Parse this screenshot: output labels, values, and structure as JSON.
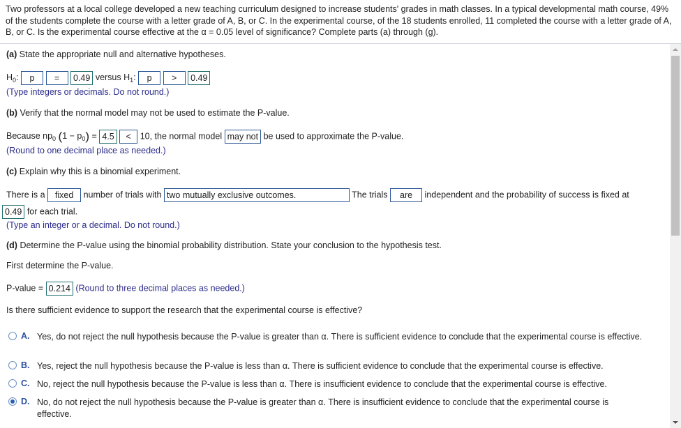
{
  "question": "Two professors at a local college developed a new teaching curriculum designed to increase students' grades in math classes. In a typical developmental math course, 49% of the students complete the course with a letter grade of A, B, or C. In the experimental course, of the 18 students enrolled, 11 completed the course with a letter grade of A, B, or C. Is the experimental course effective at the α = 0.05 level of significance? Complete parts (a) through (g).",
  "part_a": {
    "label": "(a)",
    "prompt": "State the appropriate null and alternative hypotheses.",
    "h0_label": "H",
    "h0_sub": "0",
    "h0_param": "p",
    "h0_op": "=",
    "h0_value": "0.49",
    "versus": "versus H",
    "h1_sub": "1",
    "h1_param": "p",
    "h1_op": ">",
    "h1_value": "0.49",
    "hint": "(Type integers or decimals. Do not round.)"
  },
  "part_b": {
    "label": "(b)",
    "prompt": "Verify that the normal model may not be used to estimate the P-value.",
    "because": "Because np",
    "sub0": "0",
    "one_minus": "1 − p",
    "equals": "=",
    "value": "4.5",
    "op": "<",
    "after_op": "10, the normal model",
    "may": "may not",
    "tail": "be used to approximate the P-value.",
    "hint": "(Round to one decimal place as needed.)"
  },
  "part_c": {
    "label": "(c)",
    "prompt": "Explain why this is a binomial experiment.",
    "text1": "There is a",
    "fixed": "fixed",
    "text2": "number of trials with",
    "outcomes": "two mutually exclusive outcomes.",
    "text3": "The trials",
    "are": "are",
    "text4": "independent and the probability of success is fixed at",
    "prob": "0.49",
    "text5": "for each trial.",
    "hint": "(Type an integer or a decimal. Do not round.)"
  },
  "part_d": {
    "label": "(d)",
    "prompt": "Determine the P-value using the binomial probability distribution. State your conclusion to the hypothesis test.",
    "first": "First determine the P-value.",
    "pvalue_label": "P-value =",
    "pvalue": "0.214",
    "hint": "(Round to three decimal places as needed.)",
    "question": "Is there sufficient evidence to support the research that the experimental course is effective?",
    "choices": [
      {
        "letter": "A.",
        "text": "Yes, do not reject the null hypothesis because the P-value is greater than α. There is sufficient evidence to conclude that the experimental course is effective.",
        "selected": false
      },
      {
        "letter": "B.",
        "text": "Yes, reject the null hypothesis because the P-value is less than α. There is sufficient evidence to conclude that the experimental course is effective.",
        "selected": false
      },
      {
        "letter": "C.",
        "text": "No, reject the null hypothesis because the P-value is less than α. There is insufficient evidence to conclude that the experimental course is effective.",
        "selected": false
      },
      {
        "letter": "D.",
        "text": "No, do not reject the null hypothesis because the P-value is greater than α. There is insufficient evidence to conclude that the experimental course is effective.",
        "selected": true
      }
    ]
  }
}
